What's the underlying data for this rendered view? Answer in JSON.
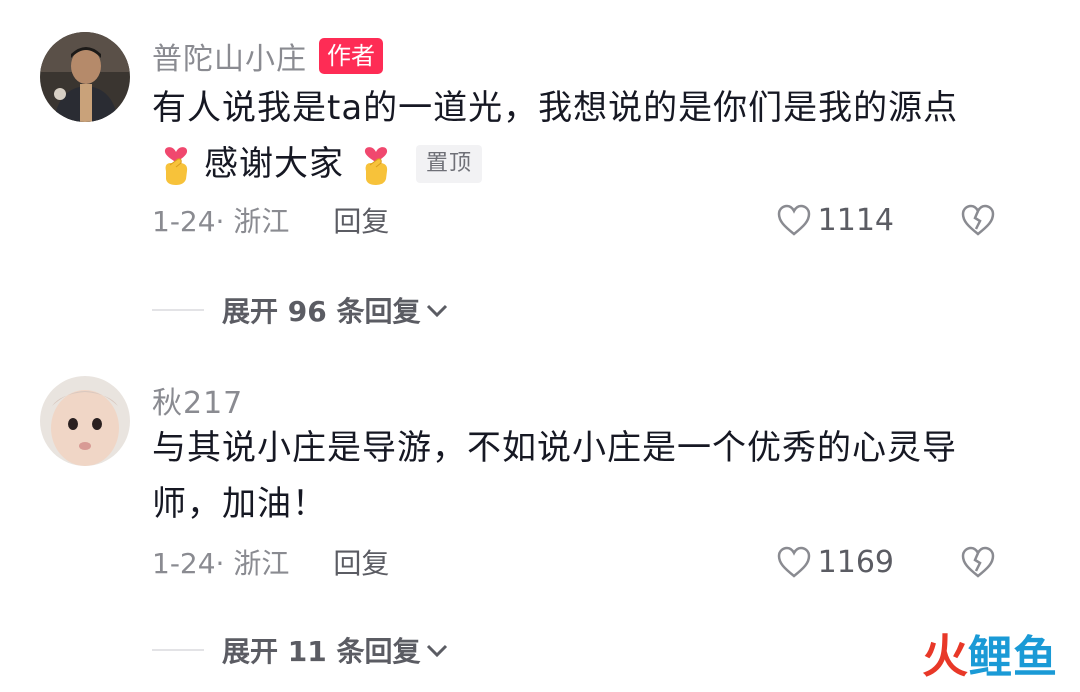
{
  "comments": [
    {
      "username": "普陀山小庄",
      "author_badge": "作者",
      "line1": "有人说我是ta的一道光，我想说的是你们是我的源点",
      "line2": "感谢大家",
      "emoji": "finger-heart-emoji",
      "pin_badge": "置顶",
      "date_location": "1-24· 浙江",
      "reply_label": "回复",
      "likes": "1114",
      "expand_label": "展开 96 条回复"
    },
    {
      "username": "秋217",
      "line1": "与其说小庄是导游，不如说小庄是一个优秀的心灵导",
      "line2": "师，加油！",
      "date_location": "1-24· 浙江",
      "reply_label": "回复",
      "likes": "1169",
      "expand_label": "展开 11 条回复"
    }
  ],
  "watermark": {
    "part1": "火",
    "part2": "鲤鱼"
  },
  "colors": {
    "author_badge": "#fe2c55",
    "text_primary": "#161823",
    "text_secondary": "#8a8b91"
  }
}
